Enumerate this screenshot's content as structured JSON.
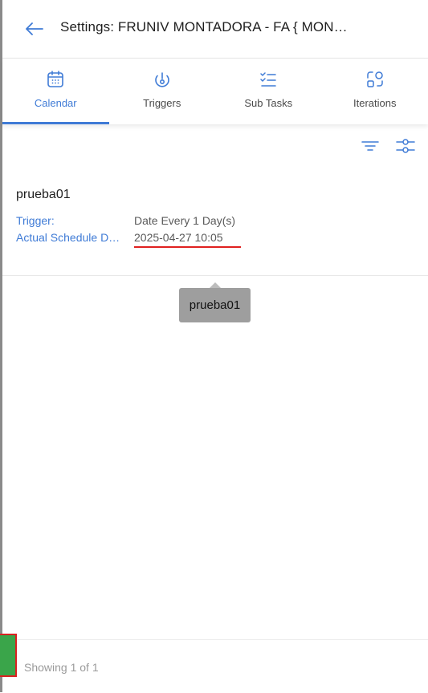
{
  "header": {
    "title": "Settings: FRUNIV MONTADORA - FA { MON…",
    "back_icon": "arrow-left-icon"
  },
  "tabs": [
    {
      "label": "Calendar",
      "icon": "calendar-icon",
      "active": true
    },
    {
      "label": "Triggers",
      "icon": "trigger-icon",
      "active": false
    },
    {
      "label": "Sub Tasks",
      "icon": "checklist-icon",
      "active": false
    },
    {
      "label": "Iterations",
      "icon": "iterations-icon",
      "active": false
    }
  ],
  "toolbar": {
    "filter_icon": "filter-icon",
    "settings_icon": "sliders-icon"
  },
  "record": {
    "name": "prueba01",
    "trigger_label": "Trigger:",
    "trigger_value": "Date Every 1 Day(s)",
    "schedule_label": "Actual Schedule D…",
    "schedule_value": "2025-04-27 10:05"
  },
  "tooltip": {
    "text": "prueba01"
  },
  "footer": {
    "status": "Showing 1 of 1"
  },
  "colors": {
    "accent": "#3f7bd6",
    "underline": "#e0201f",
    "fab": "#3aa54a"
  }
}
